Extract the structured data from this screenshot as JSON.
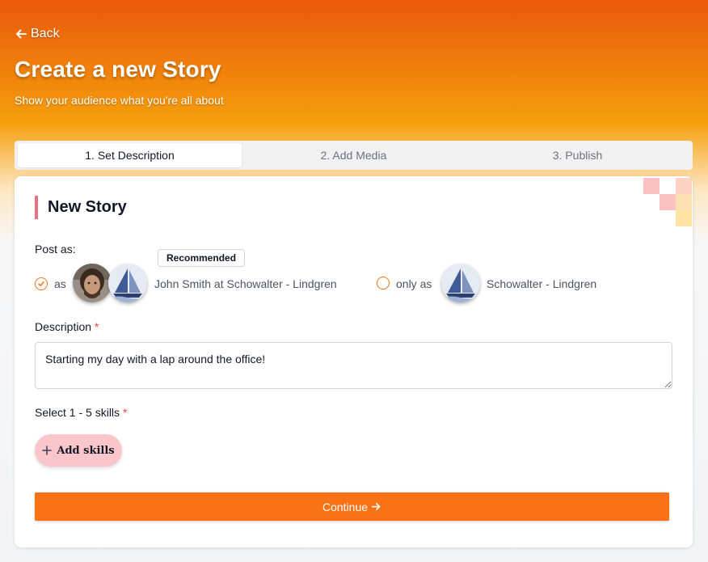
{
  "header": {
    "back_label": "Back",
    "title": "Create a new Story",
    "subtitle": "Show your audience what you're all about"
  },
  "tabs": [
    {
      "label": "1. Set Description",
      "active": true
    },
    {
      "label": "2. Add Media",
      "active": false
    },
    {
      "label": "3. Publish",
      "active": false
    }
  ],
  "card": {
    "title": "New Story",
    "post_as": {
      "label": "Post as:",
      "recommended_badge": "Recommended",
      "option1": {
        "prefix": "as",
        "name": "John Smith at Schowalter - Lindgren",
        "selected": true
      },
      "option2": {
        "prefix": "only as",
        "name": "Schowalter - Lindgren",
        "selected": false
      }
    },
    "description": {
      "label": "Description",
      "required_mark": "*",
      "value": "Starting my day with a lap around the office!"
    },
    "skills": {
      "label": "Select 1 - 5 skills",
      "required_mark": "*",
      "add_button": "Add skills"
    },
    "continue_label": "Continue"
  },
  "colors": {
    "accent": "#f97316",
    "title_bar": "#e57382",
    "skills_button": "#fbc6cb"
  }
}
